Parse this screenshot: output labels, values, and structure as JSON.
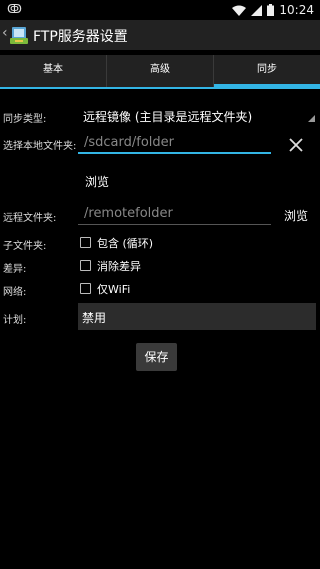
{
  "status_bar": {
    "left_icon": "ghost-notification-icon",
    "time": "10:24",
    "icons": [
      "wifi-icon",
      "cellular-signal-icon",
      "battery-icon"
    ]
  },
  "action_bar": {
    "title": "FTP服务器设置",
    "back_icon": "chevron-left-icon",
    "app_icon": "ftp-server-app-icon"
  },
  "tabs": [
    {
      "label": "基本",
      "active": false
    },
    {
      "label": "高级",
      "active": false
    },
    {
      "label": "同步",
      "active": true
    }
  ],
  "form": {
    "sync_type": {
      "label": "同步类型:",
      "value": "远程镜像 (主目录是远程文件夹)"
    },
    "local_folder": {
      "label": "选择本地文件夹:",
      "placeholder": "/sdcard/folder"
    },
    "browse_local": "浏览",
    "remote_folder": {
      "label": "远程文件夹:",
      "placeholder": "/remotefolder"
    },
    "browse_remote": "浏览",
    "subfolders": {
      "label": "子文件夹:",
      "checkbox_label": "包含 (循环)",
      "checked": false
    },
    "diff": {
      "label": "差异:",
      "checkbox_label": "消除差异",
      "checked": false
    },
    "network": {
      "label": "网络:",
      "checkbox_label": "仅WiFi",
      "checked": false
    },
    "schedule": {
      "label": "计划:",
      "value": "禁用"
    },
    "save_label": "保存"
  },
  "colors": {
    "accent": "#33b5e5",
    "background": "#000000",
    "bar": "#222222"
  }
}
